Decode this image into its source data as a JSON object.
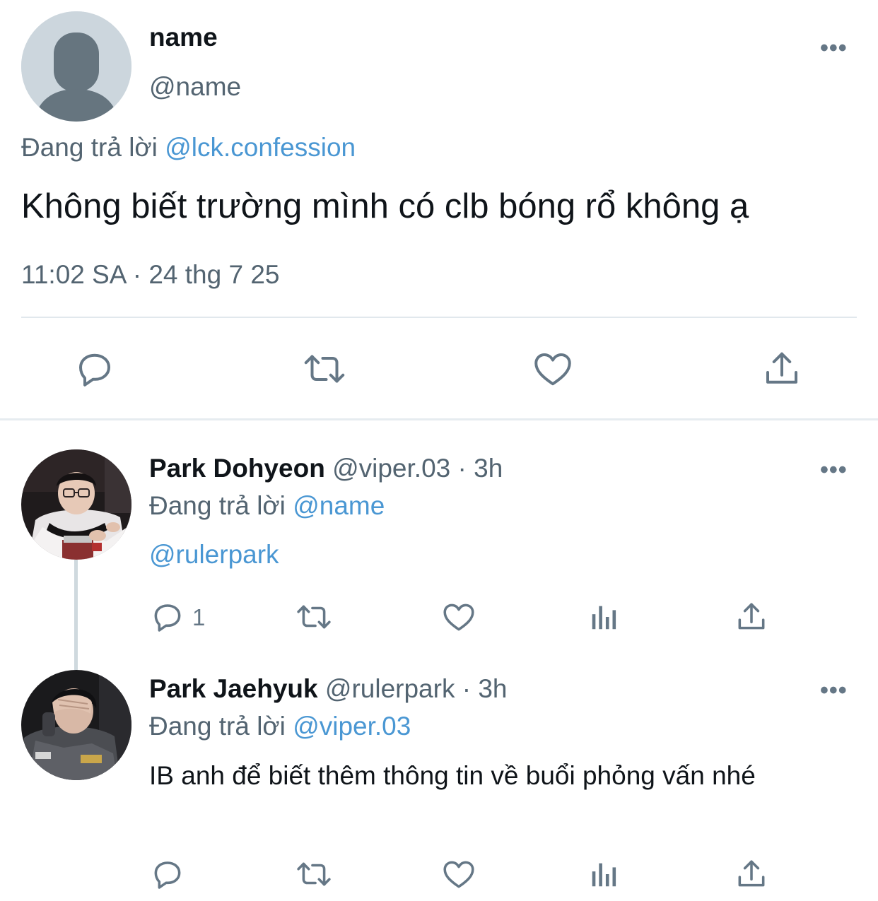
{
  "main_tweet": {
    "display_name": "name",
    "handle": "@name",
    "replying_prefix": "Đang trả lời",
    "replying_to": "@lck.confession",
    "text": "Không biết trường mình có clb bóng rổ không ạ",
    "timestamp": "11:02 SA · 24 thg 7 25",
    "more_label": "•••",
    "actions": [
      "reply-icon",
      "retweet-icon",
      "like-icon",
      "share-icon"
    ]
  },
  "replies": [
    {
      "display_name": "Park Dohyeon",
      "handle": "@viper.03",
      "time": "· 3h",
      "replying_prefix": "Đang trả lời",
      "replying_to": "@name",
      "text": "@rulerpark",
      "reply_count": "1",
      "more_label": "•••",
      "actions": [
        "reply-icon",
        "retweet-icon",
        "like-icon",
        "analytics-icon",
        "share-icon"
      ]
    },
    {
      "display_name": "Park Jaehyuk",
      "handle": "@rulerpark",
      "time": "· 3h",
      "replying_prefix": "Đang trả lời",
      "replying_to": "@viper.03",
      "text": "IB anh để biết thêm thông tin về buổi phỏng vấn nhé",
      "reply_count": "",
      "more_label": "•••",
      "actions": [
        "reply-icon",
        "retweet-icon",
        "like-icon",
        "analytics-icon",
        "share-icon"
      ]
    }
  ],
  "colors": {
    "link": "#4a97d3",
    "secondary_text": "#536471",
    "icon": "#657786",
    "divider": "#e1e8ed",
    "avatar_placeholder": "#ccd6dd"
  }
}
